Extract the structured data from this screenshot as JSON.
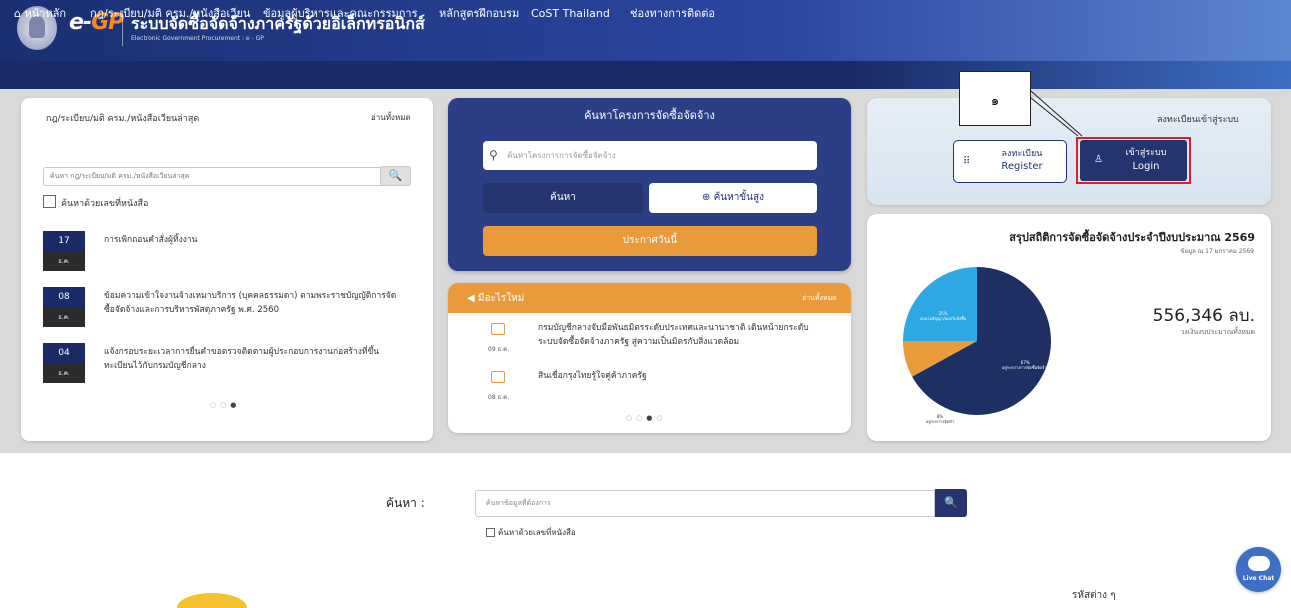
{
  "header": {
    "logo_e": "e-",
    "logo_gp": "GP",
    "title": "ระบบจัดซื้อจัดจ้างภาครัฐด้วยอิเล็กทรอนิกส์",
    "subtitle": "Electronic Government Procurement : e - GP"
  },
  "nav": {
    "items": [
      {
        "label": "หน้าหลัก"
      },
      {
        "label": "กฎ/ระเบียบ/มติ ครม./หนังสือเวียน"
      },
      {
        "label": "ข้อมูลผู้บริหารและคณะกรรมการ"
      },
      {
        "label": "หลักสูตรฝึกอบรม"
      },
      {
        "label": "CoST Thailand"
      },
      {
        "label": "ช่องทางการติดต่อ"
      }
    ]
  },
  "left": {
    "title": "กฎ/ระเบียบ/มติ ครม./หนังสือเวียนล่าสุด",
    "read_all": "อ่านทั้งหมด",
    "search_placeholder": "ค้นหา กฎ/ระเบียบ/มติ ครม./หนังสือเวียนล่าสุด",
    "search_btn": "🔍",
    "checkbox_label": "ค้นหาด้วยเลขที่หนังสือ",
    "news": [
      {
        "day": "17",
        "month": "ธ.ค.",
        "text": "การเพิกถอนคำสั่งผู้ทิ้งงาน"
      },
      {
        "day": "08",
        "month": "ธ.ค.",
        "text": "ข้อมความเข้าใจงานจ้างเหมาบริการ (บุคคลธรรมดา) ตามพระราชบัญญัติการจัดซื้อจัดจ้างและการบริหารพัสดุภาครัฐ พ.ศ. 2560"
      },
      {
        "day": "04",
        "month": "ธ.ค.",
        "text": "แจ้งกรอบระยะเวลาการยื่นคำขอตรวจติดตามผู้ประกอบการงานก่อสร้างที่ขึ้นทะเบียนไว้กับกรมบัญชีกลาง"
      }
    ]
  },
  "middle": {
    "title": "ค้นหาโครงการจัดซื้อจัดจ้าง",
    "search_placeholder": "ค้นหาโครงการการจัดซื้อจัดจ้าง",
    "btn_search": "ค้นหา",
    "btn_advanced": "ค้นหาขั้นสูง",
    "btn_today": "ประกาศวันนี้"
  },
  "new_info": {
    "title": "มีอะไรใหม่",
    "read_all": "อ่านทั้งหมด",
    "items": [
      {
        "date": "09 ธ.ค.",
        "text": "กรมบัญชีกลางจับมือพันธมิตรระดับประเทศและนานาชาติ เดินหน้ายกระดับระบบจัดซื้อจัดจ้างภาครัฐ สู่ความเป็นมิตรกับสิ่งแวดล้อม"
      },
      {
        "date": "08 ธ.ค.",
        "text": "สินเชื่อกรุงไทยรู้ใจคู่ค้าภาครัฐ"
      }
    ]
  },
  "login_card": {
    "title": "ลงทะเบียนเข้าสู่ระบบ",
    "register_th": "ลงทะเบียน",
    "register_en": "Register",
    "login_th": "เข้าสู่ระบบ",
    "login_en": "Login",
    "callout": "๑"
  },
  "stats": {
    "title": "สรุปสถิติการจัดซื้อจัดจ้างประจำปีงบประมาณ 2569",
    "subtitle": "ข้อมูล ณ 17 มกราคม 2569",
    "amount": "556,346 ลบ.",
    "amount_label": "วงเงินงบประมาณทั้งหมด",
    "colors": {
      "navy": "#1e2f63",
      "orange": "#e99a3a",
      "blue": "#2ea8e2"
    }
  },
  "chart_data": {
    "type": "pie",
    "slices": [
      {
        "label": "อยู่ระหว่างการจัดซื้อจัดจ้าง",
        "pct_label": "67%",
        "value": 67,
        "color": "#1e2f63"
      },
      {
        "label": "อยู่ระหว่างจัดทำ",
        "pct_label": "8%",
        "value": 8,
        "color": "#e99a3a"
      },
      {
        "label": "ลงนามสัญญา/ออกใบสั่งซื้อ",
        "pct_label": "25%",
        "value": 25,
        "color": "#2ea8e2"
      }
    ]
  },
  "bottom": {
    "search_label": "ค้นหา :",
    "search_placeholder": "ค้นหาข้อมูลที่ต้องการ",
    "checkbox_label": "ค้นหาด้วยเลขที่หนังสือ",
    "search_btn": "🔍",
    "live_chat": "Live Chat",
    "footer_text": "รหัสต่าง ๆ"
  }
}
